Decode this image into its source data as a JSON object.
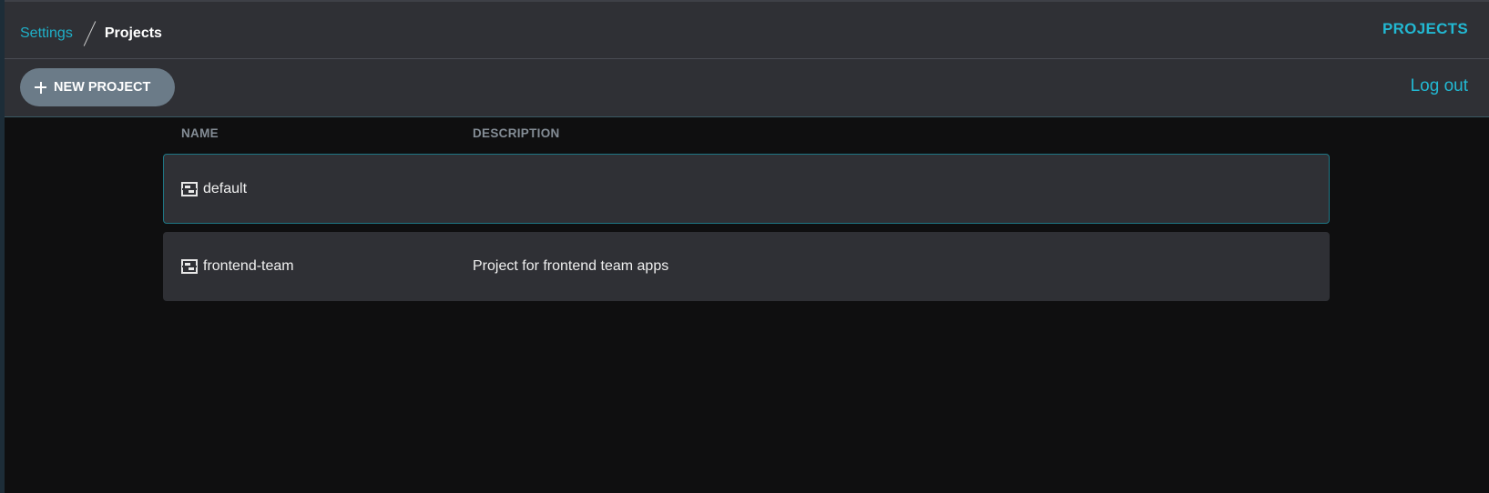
{
  "breadcrumb": {
    "parent": "Settings",
    "current": "Projects"
  },
  "header": {
    "title": "PROJECTS"
  },
  "toolbar": {
    "new_project_label": "NEW PROJECT",
    "logout_label": "Log out"
  },
  "table": {
    "columns": [
      "NAME",
      "DESCRIPTION"
    ],
    "rows": [
      {
        "name": "default",
        "description": "",
        "icon": "project-icon",
        "selected": true
      },
      {
        "name": "frontend-team",
        "description": "Project for frontend team apps",
        "icon": "project-icon",
        "selected": false
      }
    ]
  },
  "colors": {
    "accent": "#22b8d2",
    "bar_bg": "#2f3035",
    "page_bg": "#0f0f10",
    "button_bg": "#6b7b88",
    "selected_border": "#1e7684"
  }
}
